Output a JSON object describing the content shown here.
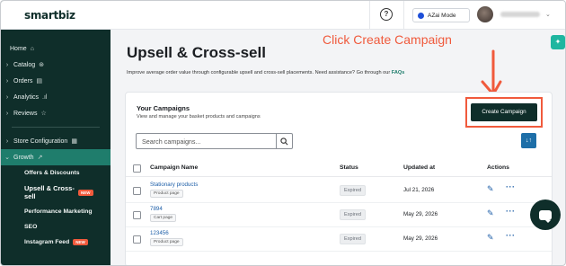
{
  "app": {
    "logo": "smartbiz"
  },
  "header": {
    "help_icon": "question-circle-icon",
    "azai_label": "AZai Mode"
  },
  "sidebar": {
    "items": [
      {
        "label": "Home",
        "icon": "home-icon",
        "glyph": "⌂",
        "chevron": ""
      },
      {
        "label": "Catalog",
        "icon": "catalog-icon",
        "glyph": "⊛",
        "chevron": "›"
      },
      {
        "label": "Orders",
        "icon": "orders-icon",
        "glyph": "▤",
        "chevron": "›"
      },
      {
        "label": "Analytics",
        "icon": "bar-chart-icon",
        "glyph": ".ıl",
        "chevron": "›"
      },
      {
        "label": "Reviews",
        "icon": "star-icon",
        "glyph": "☆",
        "chevron": "›"
      },
      {
        "label": "Store Configuration",
        "icon": "store-icon",
        "glyph": "▦",
        "chevron": "›"
      },
      {
        "label": "Growth",
        "icon": "growth-icon",
        "glyph": "↗",
        "chevron": "⌄"
      }
    ],
    "growth_sub": [
      {
        "label": "Offers & Discounts"
      },
      {
        "label": "Upsell & Cross-sell",
        "badge": "NEW"
      },
      {
        "label": "Performance Marketing"
      },
      {
        "label": "SEO"
      },
      {
        "label": "Instagram Feed",
        "badge": "NEW"
      }
    ]
  },
  "page": {
    "title": "Upsell & Cross-sell",
    "description": "Improve average order value through configurable upsell and cross-sell placements. Need assistance? Go through our",
    "faq_link": "FAQs"
  },
  "annotation": {
    "text": "Click Create Campaign",
    "color": "#f05a3c"
  },
  "campaigns": {
    "title": "Your Campaigns",
    "subtitle": "View and manage your basket products and campaigns",
    "create_button": "Create Campaign",
    "search_placeholder": "Search campaigns...",
    "columns": {
      "name": "Campaign Name",
      "status": "Status",
      "updated": "Updated at",
      "actions": "Actions"
    },
    "rows": [
      {
        "name": "Stationary products",
        "page": "Product page",
        "status": "Expired",
        "updated": "Jul 21, 2026"
      },
      {
        "name": "7894",
        "page": "Cart page",
        "status": "Expired",
        "updated": "May 29, 2026"
      },
      {
        "name": "123456",
        "page": "Product page",
        "status": "Expired",
        "updated": "May 29, 2026"
      }
    ]
  },
  "colors": {
    "sidebar_bg": "#0f2e2a",
    "active_item": "#1f7d6c",
    "primary_button": "#0f2e2a",
    "link": "#1e5fa8",
    "annotation": "#f05a3c"
  }
}
